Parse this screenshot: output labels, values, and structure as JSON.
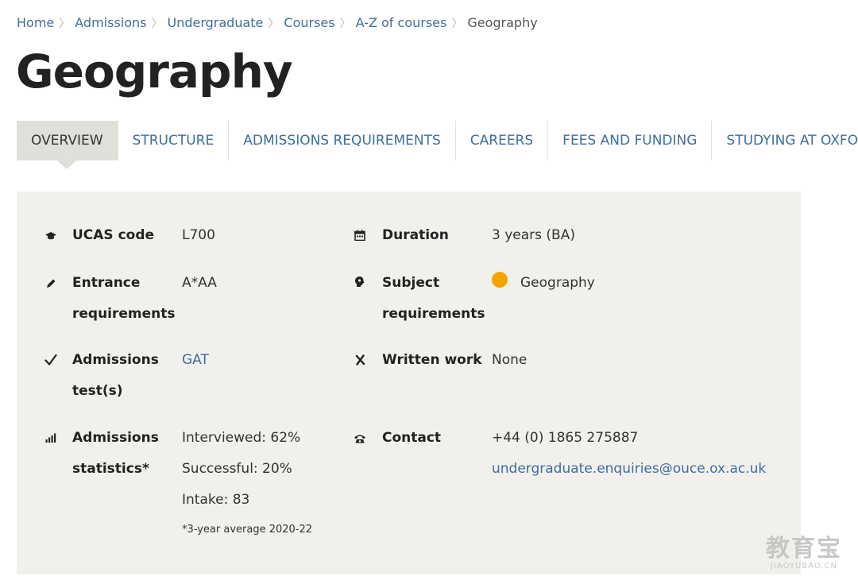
{
  "breadcrumb": {
    "items": [
      "Home",
      "Admissions",
      "Undergraduate",
      "Courses",
      "A-Z of courses"
    ],
    "current": "Geography",
    "separator": "〉"
  },
  "page": {
    "title": "Geography"
  },
  "tabs": [
    {
      "label": "OVERVIEW",
      "active": true
    },
    {
      "label": "STRUCTURE",
      "active": false
    },
    {
      "label": "ADMISSIONS REQUIREMENTS",
      "active": false
    },
    {
      "label": "CAREERS",
      "active": false
    },
    {
      "label": "FEES AND FUNDING",
      "active": false
    },
    {
      "label": "STUDYING AT OXFORD",
      "active": false
    }
  ],
  "overview": {
    "ucas": {
      "icon": "graduation-cap-icon",
      "label": "UCAS code",
      "value": "L700"
    },
    "duration": {
      "icon": "calendar-icon",
      "label": "Duration",
      "value": "3 years (BA)"
    },
    "entrance": {
      "icon": "pencil-icon",
      "label_1": "Entrance",
      "label_2": "requirements",
      "value": "A*AA"
    },
    "subject": {
      "icon": "head-icon",
      "label_1": "Subject",
      "label_2": "requirements",
      "value": "Geography",
      "dot_color": "#f5a300"
    },
    "test": {
      "icon": "checkmark-icon",
      "label_1": "Admissions",
      "label_2": "test(s)",
      "value": "GAT"
    },
    "written": {
      "icon": "cross-icon",
      "label": "Written work",
      "value": "None"
    },
    "stats": {
      "icon": "bar-chart-icon",
      "label_1": "Admissions",
      "label_2": "statistics*",
      "interviewed": "Interviewed: 62%",
      "successful": "Successful: 20%",
      "intake": "Intake: 83",
      "footnote": "*3-year average 2020-22"
    },
    "contact": {
      "icon": "telephone-icon",
      "label": "Contact",
      "phone": "+44 (0) 1865 275887",
      "email": "undergraduate.enquiries@ouce.ox.ac.uk"
    }
  },
  "watermark": {
    "main": "教育宝",
    "sub": "JIAOYUBAO.CN"
  },
  "colors": {
    "link": "#3f6e9d",
    "panel_bg": "#f1f0ec",
    "active_tab_bg": "#e0dfd9",
    "subject_dot": "#f5a300"
  }
}
